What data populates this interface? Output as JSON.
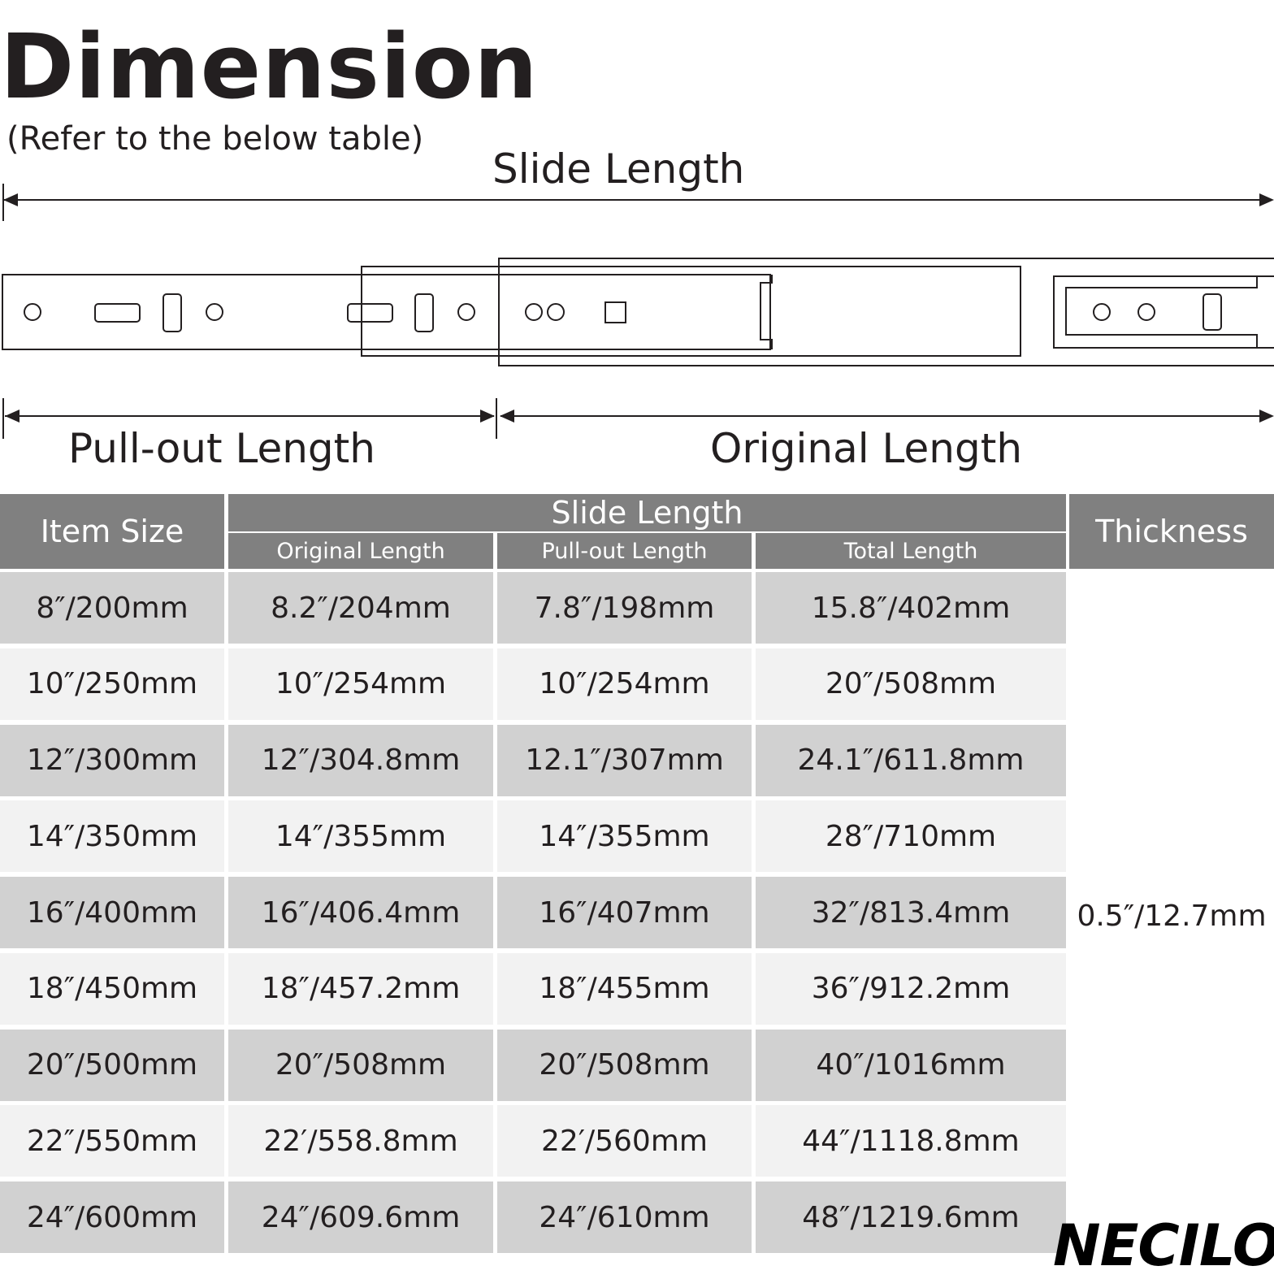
{
  "header": {
    "title": "Dimension",
    "subtitle": "(Refer to the below table)"
  },
  "diagram": {
    "slide_length_label": "Slide Length",
    "pullout_length_label": "Pull-out Length",
    "original_length_label": "Original Length"
  },
  "table": {
    "headers": {
      "item_size": "Item Size",
      "slide_length": "Slide Length",
      "original_length": "Original Length",
      "pullout_length": "Pull-out Length",
      "total_length": "Total Length",
      "thickness": "Thickness"
    },
    "rows": [
      [
        "8″/200mm",
        "8.2″/204mm",
        "7.8″/198mm",
        "15.8″/402mm"
      ],
      [
        "10″/250mm",
        "10″/254mm",
        "10″/254mm",
        "20″/508mm"
      ],
      [
        "12″/300mm",
        "12″/304.8mm",
        "12.1″/307mm",
        "24.1″/611.8mm"
      ],
      [
        "14″/350mm",
        "14″/355mm",
        "14″/355mm",
        "28″/710mm"
      ],
      [
        "16″/400mm",
        "16″/406.4mm",
        "16″/407mm",
        "32″/813.4mm"
      ],
      [
        "18″/450mm",
        "18″/457.2mm",
        "18″/455mm",
        "36″/912.2mm"
      ],
      [
        "20″/500mm",
        "20″/508mm",
        "20″/508mm",
        "40″/1016mm"
      ],
      [
        "22″/550mm",
        "22′/558.8mm",
        "22′/560mm",
        "44″/1118.8mm"
      ],
      [
        "24″/600mm",
        "24″/609.6mm",
        "24″/610mm",
        "48″/1219.6mm"
      ]
    ],
    "thickness_value": "0.5″/12.7mm"
  },
  "brand": {
    "logo_text": "NECILO"
  },
  "colors": {
    "header_bg": "#808080",
    "row_dark": "#d1d1d1",
    "row_light": "#f2f2f2",
    "text": "#231f20"
  }
}
